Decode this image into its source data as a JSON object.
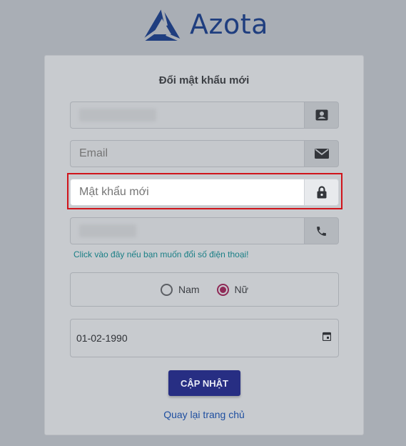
{
  "brand": {
    "name": "Azota",
    "color": "#1f3e7f"
  },
  "form": {
    "title": "Đổi mật khẩu mới",
    "email_placeholder": "Email",
    "new_password_placeholder": "Mật khẩu mới",
    "change_phone_link": "Click vào đây nếu bạn muốn đổi số điện thoại!",
    "gender": {
      "options": [
        {
          "label": "Nam",
          "checked": false
        },
        {
          "label": "Nữ",
          "checked": true
        }
      ]
    },
    "birthdate": "01-02-1990",
    "update_button": "CẬP NHẬT",
    "home_link": "Quay lại trang chủ"
  },
  "icons": {
    "name_field": "contact-card-icon",
    "email_field": "envelope-icon",
    "password_field": "lock-icon",
    "phone_field": "phone-icon",
    "date_field": "calendar-icon"
  },
  "colors": {
    "highlight": "#d0141b",
    "primary_button": "#272e83",
    "link": "#1f4fa0",
    "radio_checked": "#8f2a57"
  }
}
